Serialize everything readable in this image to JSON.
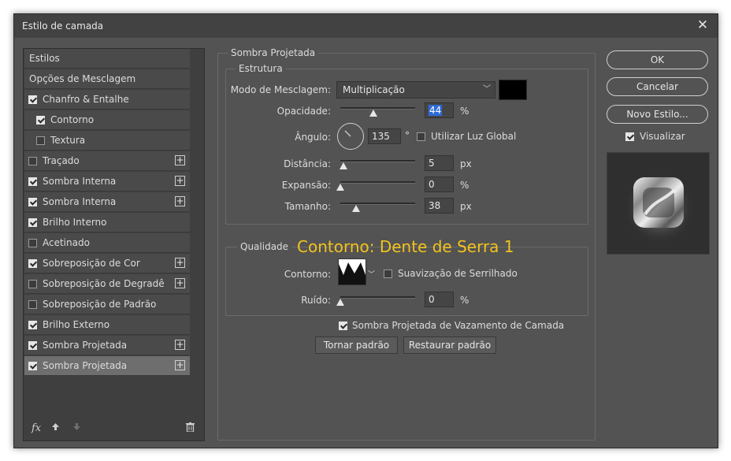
{
  "window": {
    "title": "Estilo de camada"
  },
  "styles": [
    {
      "label": "Estilos",
      "checkbox": false,
      "checked": false,
      "plus": false,
      "indent": false
    },
    {
      "label": "Opções de Mesclagem",
      "checkbox": false,
      "checked": false,
      "plus": false,
      "indent": false
    },
    {
      "label": "Chanfro & Entalhe",
      "checkbox": true,
      "checked": true,
      "plus": false,
      "indent": false
    },
    {
      "label": "Contorno",
      "checkbox": true,
      "checked": true,
      "plus": false,
      "indent": true
    },
    {
      "label": "Textura",
      "checkbox": true,
      "checked": false,
      "plus": false,
      "indent": true
    },
    {
      "label": "Traçado",
      "checkbox": true,
      "checked": false,
      "plus": true,
      "indent": false
    },
    {
      "label": "Sombra Interna",
      "checkbox": true,
      "checked": true,
      "plus": true,
      "indent": false
    },
    {
      "label": "Sombra Interna",
      "checkbox": true,
      "checked": true,
      "plus": true,
      "indent": false
    },
    {
      "label": "Brilho Interno",
      "checkbox": true,
      "checked": true,
      "plus": false,
      "indent": false
    },
    {
      "label": "Acetinado",
      "checkbox": true,
      "checked": false,
      "plus": false,
      "indent": false
    },
    {
      "label": "Sobreposição de Cor",
      "checkbox": true,
      "checked": true,
      "plus": true,
      "indent": false
    },
    {
      "label": "Sobreposição de Degradê",
      "checkbox": true,
      "checked": false,
      "plus": true,
      "indent": false
    },
    {
      "label": "Sobreposição de Padrão",
      "checkbox": true,
      "checked": false,
      "plus": false,
      "indent": false
    },
    {
      "label": "Brilho Externo",
      "checkbox": true,
      "checked": true,
      "plus": false,
      "indent": false
    },
    {
      "label": "Sombra Projetada",
      "checkbox": true,
      "checked": true,
      "plus": true,
      "indent": false
    },
    {
      "label": "Sombra Projetada",
      "checkbox": true,
      "checked": true,
      "plus": true,
      "indent": false,
      "active": true
    }
  ],
  "bottom_icons": {
    "fx": "fx"
  },
  "panel": {
    "title": "Sombra Projetada",
    "estrutura": {
      "title": "Estrutura",
      "blend_label": "Modo de Mesclagem:",
      "blend_value": "Multiplicação",
      "shadow_color": "#000000",
      "opacity_label": "Opacidade:",
      "opacity_value": "44",
      "opacity_unit": "%",
      "angle_label": "Ângulo:",
      "angle_value": "135",
      "angle_unit": "°",
      "global_light_label": "Utilizar Luz Global",
      "global_light_checked": false,
      "distance_label": "Distância:",
      "distance_value": "5",
      "distance_unit": "px",
      "spread_label": "Expansão:",
      "spread_value": "0",
      "spread_unit": "%",
      "size_label": "Tamanho:",
      "size_value": "38",
      "size_unit": "px"
    },
    "qualidade": {
      "title": "Qualidade",
      "annotation": "Contorno: Dente de Serra 1",
      "contour_label": "Contorno:",
      "antialias_label": "Suavização de Serrilhado",
      "antialias_checked": false,
      "noise_label": "Ruído:",
      "noise_value": "0",
      "noise_unit": "%"
    },
    "knockout_label": "Sombra Projetada de Vazamento de Camada",
    "knockout_checked": true,
    "make_default": "Tornar padrão",
    "reset_default": "Restaurar padrão"
  },
  "actions": {
    "ok": "OK",
    "cancel": "Cancelar",
    "new_style": "Novo Estilo...",
    "preview_label": "Visualizar",
    "preview_checked": true
  }
}
